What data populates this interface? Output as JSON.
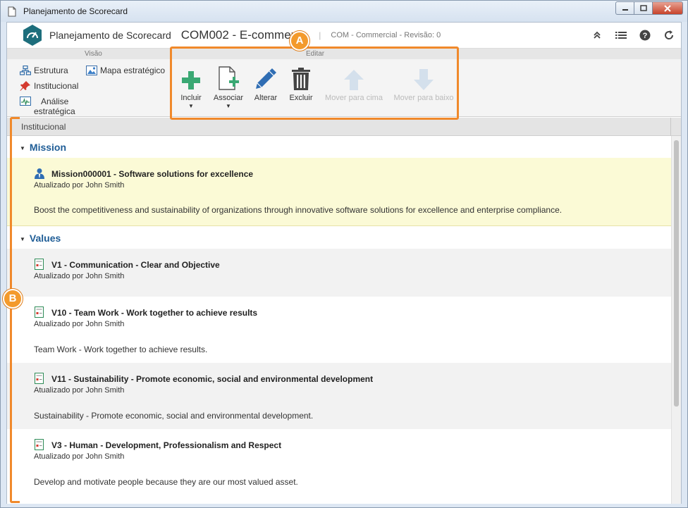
{
  "window": {
    "title": "Planejamento de Scorecard"
  },
  "header": {
    "app_title": "Planejamento de Scorecard",
    "record_title": "COM002 - E-commerce",
    "separator": "|",
    "subinfo": "COM - Commercial - Revisão: 0"
  },
  "toolbar": {
    "visao_label": "Visão",
    "editar_label": "Editar",
    "visao_items": {
      "estrutura": "Estrutura",
      "institucional": "Institucional",
      "analise_line1": "Análise",
      "analise_line2": "estratégica",
      "mapa": "Mapa estratégico"
    },
    "tools": {
      "incluir": "Incluir",
      "associar": "Associar",
      "alterar": "Alterar",
      "excluir": "Excluir",
      "mover_cima": "Mover para cima",
      "mover_baixo": "Mover para baixo"
    }
  },
  "content": {
    "section_header": "Institucional",
    "mission": {
      "group_title": "Mission",
      "item": {
        "title": "Mission000001 - Software solutions for excellence",
        "updated": "Atualizado por John Smith",
        "description": "Boost the competitiveness and sustainability of organizations through innovative software solutions for excellence and enterprise compliance."
      }
    },
    "values": {
      "group_title": "Values",
      "items": [
        {
          "title": "V1 - Communication - Clear and Objective",
          "updated": "Atualizado por John Smith",
          "description": ""
        },
        {
          "title": "V10 - Team Work - Work together to achieve results",
          "updated": "Atualizado por John Smith",
          "description": "Team Work - Work together to achieve results."
        },
        {
          "title": "V11 - Sustainability - Promote economic, social and environmental development",
          "updated": "Atualizado por John Smith",
          "description": "Sustainability - Promote economic, social and environmental development."
        },
        {
          "title": "V3 - Human - Development, Professionalism and Respect",
          "updated": "Atualizado por John Smith",
          "description": "Develop and motivate people because they are our most valued asset."
        }
      ]
    }
  },
  "callouts": {
    "a": "A",
    "b": "B"
  },
  "colors": {
    "accent_orange": "#f0892b",
    "group_title_blue": "#1f5d96",
    "highlight_row": "#fbfad6",
    "add_green": "#3aa873",
    "edit_blue": "#2f6db3"
  }
}
